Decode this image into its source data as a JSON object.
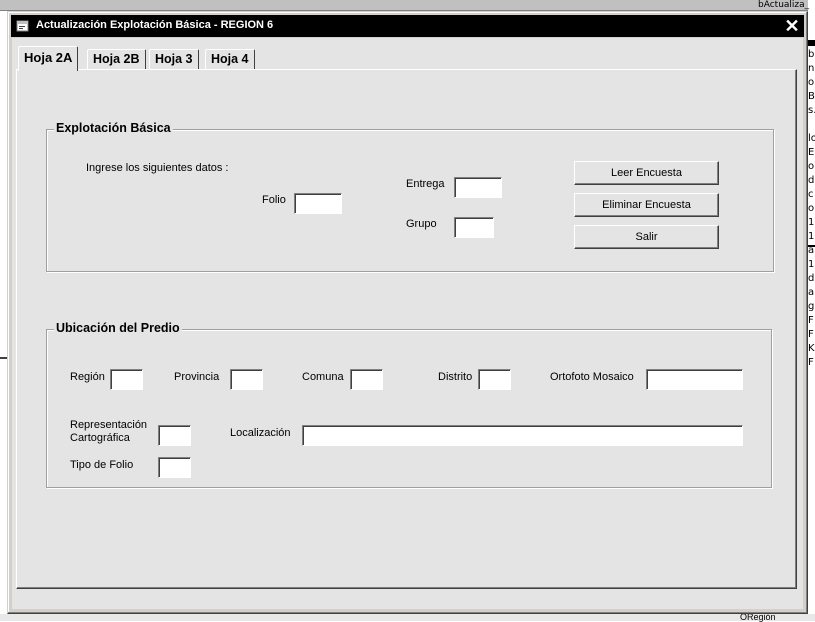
{
  "window": {
    "title": "Actualización Explotación Básica - REGION 6",
    "close_symbol": "✕"
  },
  "tabs": [
    {
      "label": "Hoja 2A",
      "active": true
    },
    {
      "label": "Hoja 2B",
      "active": false
    },
    {
      "label": "Hoja 3",
      "active": false
    },
    {
      "label": "Hoja 4",
      "active": false
    }
  ],
  "explotacion": {
    "title": "Explotación Básica",
    "instructions": "Ingrese los siguientes datos :",
    "folio_label": "Folio",
    "folio_value": "",
    "entrega_label": "Entrega",
    "entrega_value": "",
    "grupo_label": "Grupo",
    "grupo_value": "",
    "buttons": {
      "leer": "Leer  Encuesta",
      "eliminar": "Eliminar  Encuesta",
      "salir": "Salir"
    }
  },
  "ubicacion": {
    "title": "Ubicación del Predio",
    "region_label": "Región",
    "provincia_label": "Provincia",
    "comuna_label": "Comuna",
    "distrito_label": "Distrito",
    "ortofoto_label": "Ortofoto Mosaico",
    "representacion_label_1": "Representación",
    "representacion_label_2": "Cartográfica",
    "localizacion_label": "Localización",
    "tipo_folio_label": "Tipo de Folio",
    "region_value": "",
    "provincia_value": "",
    "comuna_value": "",
    "distrito_value": "",
    "ortofoto_value": "",
    "representacion_value": "",
    "localizacion_value": "",
    "tipo_folio_value": ""
  },
  "background": {
    "bottom_fragment": "ORegión",
    "top_fragment": "bActualiza_",
    "right_chars": [
      "b",
      "n",
      "o",
      "B",
      "s.",
      "",
      "lo",
      "E",
      "o",
      "d",
      "c",
      "o",
      "1",
      "1",
      "a",
      "1",
      "d",
      "a",
      "g",
      "F",
      "F",
      "K",
      "F"
    ]
  },
  "icons": {
    "app": "app-window-icon",
    "close": "close-icon"
  },
  "colors": {
    "titlebar": "#000000",
    "face": "#e4e4e4",
    "frame": "#d4d0c8"
  }
}
